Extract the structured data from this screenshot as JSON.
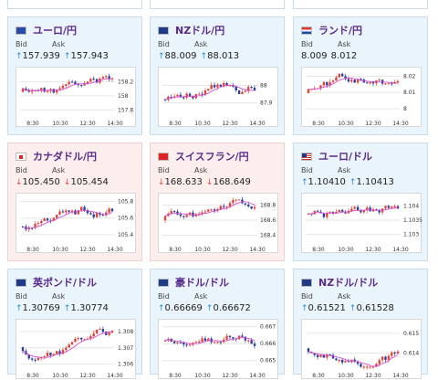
{
  "labels": {
    "bid": "Bid",
    "ask": "Ask"
  },
  "cards": [
    {
      "title": "ユーロ/円",
      "flag": "eu",
      "dir": "up",
      "bid": "157.939",
      "ask": "157.943",
      "y_ticks": [
        "158.2",
        "158",
        "157.8"
      ],
      "ylim": [
        157.7,
        158.35
      ],
      "x_ticks": [
        "8:30",
        "10:30",
        "12:30",
        "14:30"
      ]
    },
    {
      "title": "NZドル/円",
      "flag": "nz",
      "dir": "up",
      "bid": "88.009",
      "ask": "88.013",
      "y_ticks": [
        "88",
        "87.9"
      ],
      "ylim": [
        87.82,
        88.08
      ],
      "x_ticks": [
        "8:30",
        "10:30",
        "12:30",
        "14:30"
      ]
    },
    {
      "title": "ランド/円",
      "flag": "za",
      "dir": "none",
      "bid": "8.009",
      "ask": "8.012",
      "y_ticks": [
        "8.02",
        "8.01",
        "8"
      ],
      "ylim": [
        7.995,
        8.023
      ],
      "x_ticks": [
        "8:30",
        "10:30",
        "12:30",
        "14:30"
      ]
    },
    {
      "title": "カナダドル/円",
      "flag": "ca",
      "dir": "down",
      "bid": "105.450",
      "ask": "105.454",
      "y_ticks": [
        "105.8",
        "105.6",
        "105.4"
      ],
      "ylim": [
        105.3,
        105.85
      ],
      "x_ticks": [
        "8:30",
        "10:30",
        "12:30",
        "14:30"
      ]
    },
    {
      "title": "スイスフラン/円",
      "flag": "ch",
      "dir": "down",
      "bid": "168.633",
      "ask": "168.649",
      "y_ticks": [
        "168.8",
        "168.6",
        "168.4"
      ],
      "ylim": [
        168.3,
        168.9
      ],
      "x_ticks": [
        "8:30",
        "10:30",
        "12:30",
        "14:30"
      ]
    },
    {
      "title": "ユーロ/ドル",
      "flag": "us",
      "dir": "up",
      "bid": "1.10410",
      "ask": "1.10413",
      "y_ticks": [
        "1.104",
        "1.1035",
        "1.103"
      ],
      "ylim": [
        1.1027,
        1.1043
      ],
      "x_ticks": [
        "8:30",
        "10:30",
        "12:30",
        "14:30"
      ]
    },
    {
      "title": "英ポンド/ドル",
      "flag": "gb",
      "dir": "up",
      "bid": "1.30769",
      "ask": "1.30774",
      "y_ticks": [
        "1.308",
        "1.307",
        "1.306"
      ],
      "ylim": [
        1.3057,
        1.3085
      ],
      "x_ticks": [
        "8:30",
        "10:30",
        "12:30",
        "14:30"
      ]
    },
    {
      "title": "豪ドル/ドル",
      "flag": "au",
      "dir": "up",
      "bid": "0.66669",
      "ask": "0.66672",
      "y_ticks": [
        "0.667",
        "0.666",
        "0.665"
      ],
      "ylim": [
        0.6645,
        0.6672
      ],
      "x_ticks": [
        "8:30",
        "10:30",
        "12:30",
        "14:30"
      ]
    },
    {
      "title": "NZドル/ドル",
      "flag": "nz",
      "dir": "up",
      "bid": "0.61521",
      "ask": "0.61528",
      "y_ticks": [
        "0.615",
        "0.614"
      ],
      "ylim": [
        0.6132,
        0.6155
      ],
      "x_ticks": [
        "8:30",
        "10:30",
        "12:30",
        "14:30"
      ]
    }
  ],
  "colors": {
    "up_candle": "#e0443a",
    "down_candle": "#2a3f9a",
    "ma": "#d94fd2",
    "grid": "#e6e6e6"
  }
}
